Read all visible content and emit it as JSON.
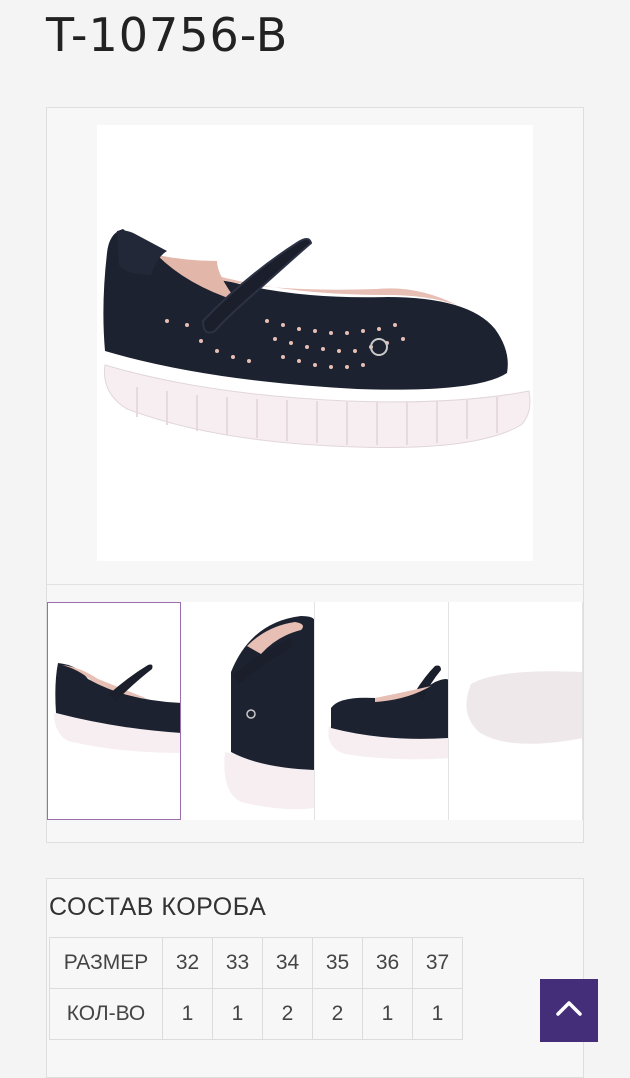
{
  "product": {
    "code": "T-10756-B"
  },
  "box": {
    "title": "СОСТАВ КОРОБА",
    "size_label": "РАЗМЕР",
    "qty_label": "КОЛ-ВО",
    "sizes": [
      "32",
      "33",
      "34",
      "35",
      "36",
      "37"
    ],
    "quantities": [
      "1",
      "1",
      "2",
      "2",
      "1",
      "1"
    ]
  },
  "colors": {
    "accent": "#452e79",
    "active_thumb_border": "#9a6fae"
  },
  "icons": {
    "scroll_top": "chevron-up-icon"
  }
}
